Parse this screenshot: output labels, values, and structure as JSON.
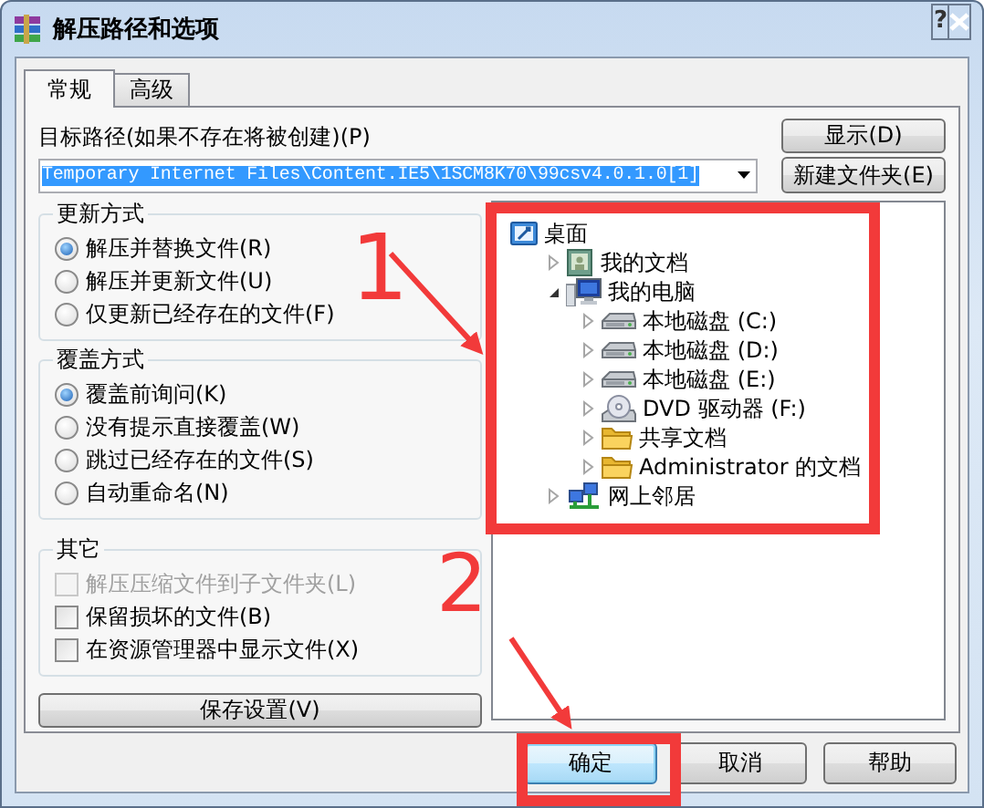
{
  "window": {
    "title": "解压路径和选项",
    "help_button": "?"
  },
  "tabs": [
    {
      "label": "常规",
      "selected": true
    },
    {
      "label": "高级",
      "selected": false
    }
  ],
  "destination": {
    "label": "目标路径(如果不存在将被创建)(P)",
    "value": "Temporary Internet Files\\Content.IE5\\1SCM8K70\\99csv4.0.1.0[1]",
    "show_button": "显示(D)",
    "new_folder_button": "新建文件夹(E)"
  },
  "update_mode": {
    "title": "更新方式",
    "options": [
      {
        "label": "解压并替换文件(R)",
        "selected": true
      },
      {
        "label": "解压并更新文件(U)",
        "selected": false
      },
      {
        "label": "仅更新已经存在的文件(F)",
        "selected": false
      }
    ]
  },
  "overwrite_mode": {
    "title": "覆盖方式",
    "options": [
      {
        "label": "覆盖前询问(K)",
        "selected": true
      },
      {
        "label": "没有提示直接覆盖(W)",
        "selected": false
      },
      {
        "label": "跳过已经存在的文件(S)",
        "selected": false
      },
      {
        "label": "自动重命名(N)",
        "selected": false
      }
    ]
  },
  "misc": {
    "title": "其它",
    "options": [
      {
        "label": "解压压缩文件到子文件夹(L)",
        "checked": false,
        "disabled": true
      },
      {
        "label": "保留损坏的文件(B)",
        "checked": false,
        "disabled": false
      },
      {
        "label": "在资源管理器中显示文件(X)",
        "checked": false,
        "disabled": false
      }
    ]
  },
  "save_button": "保存设置(V)",
  "tree": [
    {
      "label": "桌面",
      "kind": "desktop",
      "children": [
        {
          "label": "我的文档",
          "kind": "documents",
          "expanded": false
        },
        {
          "label": "我的电脑",
          "kind": "computer",
          "expanded": true,
          "children": [
            {
              "label": "本地磁盘 (C:)",
              "kind": "drive",
              "expanded": false
            },
            {
              "label": "本地磁盘 (D:)",
              "kind": "drive",
              "expanded": false
            },
            {
              "label": "本地磁盘 (E:)",
              "kind": "drive",
              "expanded": false
            },
            {
              "label": "DVD 驱动器 (F:)",
              "kind": "dvd",
              "expanded": false
            },
            {
              "label": "共享文档",
              "kind": "folder",
              "expanded": false
            },
            {
              "label": "Administrator 的文档",
              "kind": "folder",
              "expanded": false
            }
          ]
        },
        {
          "label": "网上邻居",
          "kind": "network",
          "expanded": false
        }
      ]
    }
  ],
  "buttons": [
    {
      "label": "确定",
      "selected": true
    },
    {
      "label": "取消",
      "selected": false
    },
    {
      "label": "帮助",
      "selected": false
    }
  ],
  "annotations": [
    {
      "kind": "box"
    },
    {
      "kind": "number",
      "text": "1"
    },
    {
      "kind": "arrow"
    },
    {
      "kind": "number",
      "text": "2"
    },
    {
      "kind": "arrow"
    },
    {
      "kind": "box"
    }
  ]
}
